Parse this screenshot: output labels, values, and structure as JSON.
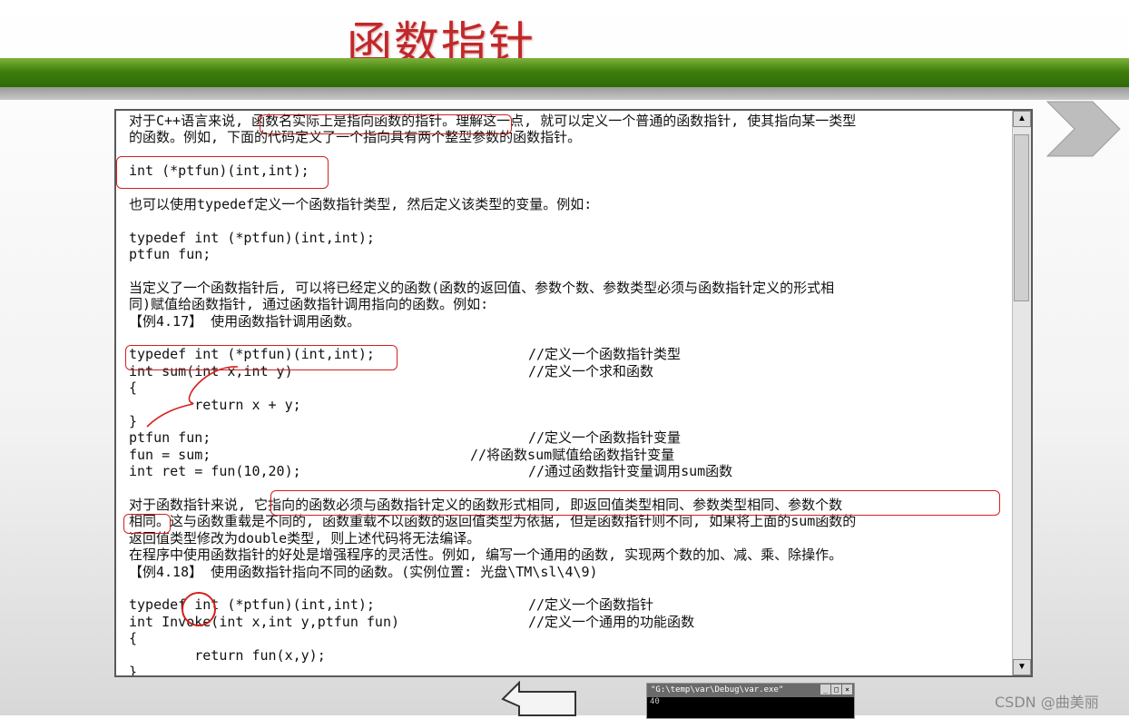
{
  "slide": {
    "title": "函数指针"
  },
  "document": {
    "lines": [
      {
        "t": "对于C++语言来说, 函数名实际上是指向函数的指针。理解这一点, 就可以定义一个普通的函数指针, 使其指向某一类型"
      },
      {
        "t": "的函数。例如, 下面的代码定义了一个指向具有两个整型参数的函数指针。"
      },
      {
        "t": ""
      },
      {
        "t": "int (*ptfun)(int,int);"
      },
      {
        "t": ""
      },
      {
        "t": "也可以使用typedef定义一个函数指针类型, 然后定义该类型的变量。例如:"
      },
      {
        "t": ""
      },
      {
        "t": "typedef int (*ptfun)(int,int);"
      },
      {
        "t": "ptfun fun;"
      },
      {
        "t": ""
      },
      {
        "t": "当定义了一个函数指针后, 可以将已经定义的函数(函数的返回值、参数个数、参数类型必须与函数指针定义的形式相"
      },
      {
        "t": "同)赋值给函数指针, 通过函数指针调用指向的函数。例如:"
      },
      {
        "t": "【例4.17】 使用函数指针调用函数。"
      },
      {
        "t": ""
      },
      {
        "t": "typedef int (*ptfun)(int,int);",
        "c1": "//定义一个函数指针类型"
      },
      {
        "t": "int sum(int x,int y)",
        "c1": "//定义一个求和函数"
      },
      {
        "t": "{"
      },
      {
        "t": "        return x + y;"
      },
      {
        "t": "}"
      },
      {
        "t": "ptfun fun;",
        "c1": "//定义一个函数指针变量"
      },
      {
        "t": "fun = sum;",
        "c2": "//将函数sum赋值给函数指针变量"
      },
      {
        "t": "int ret = fun(10,20);",
        "c1": "//通过函数指针变量调用sum函数"
      },
      {
        "t": ""
      },
      {
        "t": "对于函数指针来说, 它指向的函数必须与函数指针定义的函数形式相同, 即返回值类型相同、参数类型相同、参数个数"
      },
      {
        "t": "相同。这与函数重载是不同的, 函数重载不以函数的返回值类型为依据, 但是函数指针则不同, 如果将上面的sum函数的"
      },
      {
        "t": "返回值类型修改为double类型, 则上述代码将无法编译。"
      },
      {
        "t": "在程序中使用函数指针的好处是增强程序的灵活性。例如, 编写一个通用的函数, 实现两个数的加、减、乘、除操作。"
      },
      {
        "t": "【例4.18】 使用函数指针指向不同的函数。(实例位置: 光盘\\TM\\sl\\4\\9)"
      },
      {
        "t": ""
      },
      {
        "t": "typedef int (*ptfun)(int,int);",
        "c1": "//定义一个函数指针"
      },
      {
        "t": "int Invoke(int x,int y,ptfun fun)",
        "c1": "//定义一个通用的功能函数"
      },
      {
        "t": "{"
      },
      {
        "t": "        return fun(x,y);"
      },
      {
        "t": "}"
      }
    ]
  },
  "scrollbar": {
    "up": "▲",
    "down": "▼"
  },
  "console": {
    "title": "\"G:\\temp\\var\\Debug\\var.exe\"",
    "body": "40",
    "btn_min": "_",
    "btn_max": "□",
    "btn_close": "×"
  },
  "watermark": "CSDN @曲美丽",
  "colors": {
    "title": "#c0282a",
    "bar": "#3f7f0c",
    "annotation": "#d42020"
  }
}
